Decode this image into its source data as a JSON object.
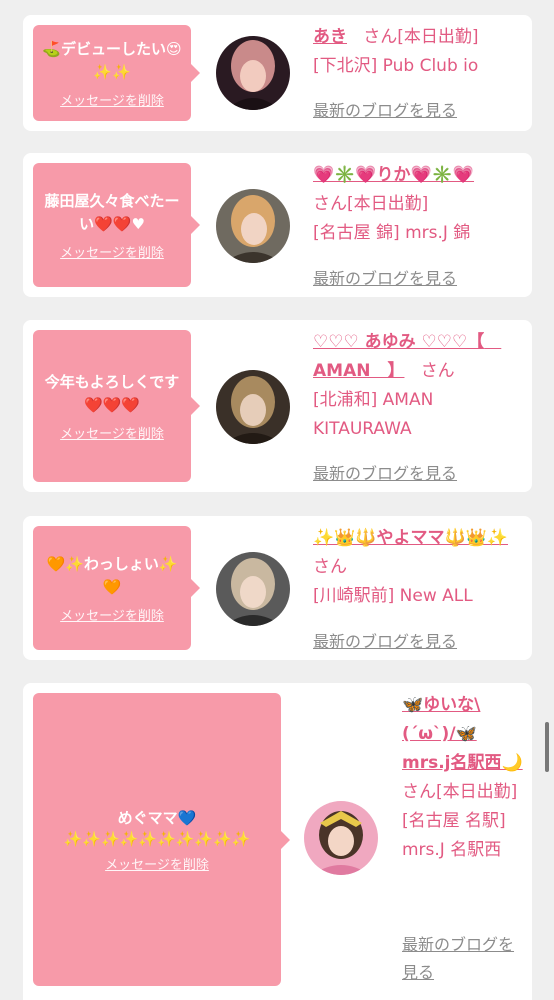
{
  "delete_label": "メッセージを削除",
  "blog_label": "最新のブログを見る",
  "honor_label": "さん",
  "cards": [
    {
      "message": "⛳デビューしたい😍✨✨",
      "name": "あき",
      "status": "[本日出勤]",
      "shop": "[下北沢] Pub Club io"
    },
    {
      "message": "藤田屋久々食べたーい❤️❤️♥",
      "name": "💗✳️💗りか💗✳️💗",
      "status": "[本日出勤]",
      "shop": "[名古屋 錦] mrs.J 錦"
    },
    {
      "message": "今年もよろしくです❤️❤️❤️",
      "name": "♡♡♡ あゆみ ♡♡♡【　AMAN　】",
      "status": "",
      "shop": "[北浦和] AMAN KITAURAWA"
    },
    {
      "message": "🧡✨わっしょい✨🧡",
      "name": "✨👑🔱やよママ🔱👑✨",
      "status": "",
      "shop": "[川崎駅前] New ALL"
    },
    {
      "message": "めぐママ💙",
      "message_sparkles": "✨✨✨✨✨✨✨✨✨✨",
      "name": "🦋ゆいな\\(´ω`)/🦋mrs.j名駅西🌙",
      "status": "[本日出勤]",
      "shop": "[名古屋 名駅] mrs.J 名駅西"
    }
  ],
  "colors": {
    "bubble": "#f79aa9",
    "accent": "#e25a82",
    "link_gray": "#8c8c8c",
    "background": "#efefef"
  }
}
